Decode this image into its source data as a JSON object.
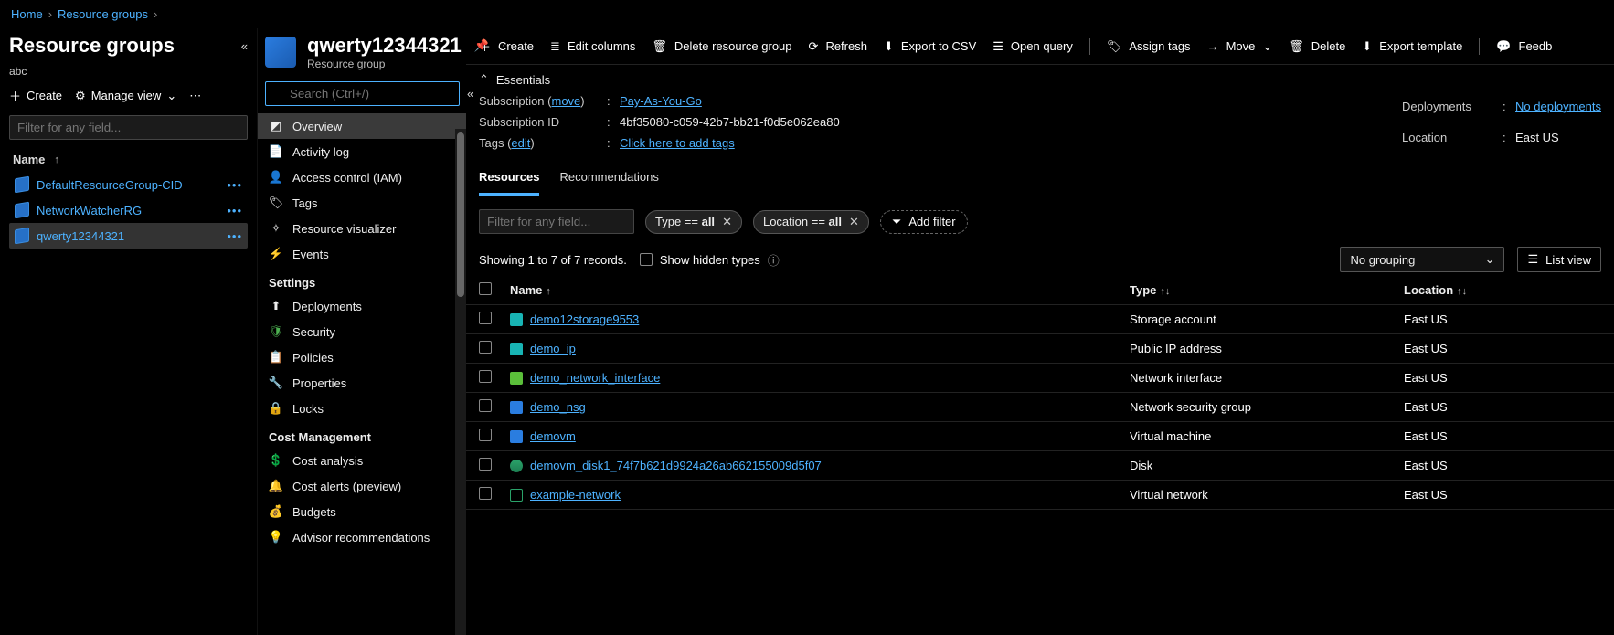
{
  "breadcrumb": {
    "home": "Home",
    "groups": "Resource groups"
  },
  "left": {
    "title": "Resource groups",
    "subtitle": "abc",
    "create": "Create",
    "manage": "Manage view",
    "filter_placeholder": "Filter for any field...",
    "name_header": "Name",
    "items": [
      {
        "name": "DefaultResourceGroup-CID"
      },
      {
        "name": "NetworkWatcherRG"
      },
      {
        "name": "qwerty12344321"
      }
    ]
  },
  "nav": {
    "title": "qwerty12344321",
    "subtitle": "Resource group",
    "search_placeholder": "Search (Ctrl+/)",
    "items": [
      {
        "label": "Overview",
        "icon": "cube",
        "selected": true
      },
      {
        "label": "Activity log",
        "icon": "log"
      },
      {
        "label": "Access control (IAM)",
        "icon": "person"
      },
      {
        "label": "Tags",
        "icon": "tag"
      },
      {
        "label": "Resource visualizer",
        "icon": "viz"
      },
      {
        "label": "Events",
        "icon": "bolt"
      }
    ],
    "section_settings": "Settings",
    "settings": [
      {
        "label": "Deployments",
        "icon": "upload"
      },
      {
        "label": "Security",
        "icon": "shield"
      },
      {
        "label": "Policies",
        "icon": "policy"
      },
      {
        "label": "Properties",
        "icon": "props"
      },
      {
        "label": "Locks",
        "icon": "lock"
      }
    ],
    "section_cost": "Cost Management",
    "cost": [
      {
        "label": "Cost analysis",
        "icon": "cost"
      },
      {
        "label": "Cost alerts (preview)",
        "icon": "alert"
      },
      {
        "label": "Budgets",
        "icon": "budget"
      },
      {
        "label": "Advisor recommendations",
        "icon": "advisor"
      }
    ]
  },
  "toolbar": {
    "create": "Create",
    "edit_columns": "Edit columns",
    "delete_rg": "Delete resource group",
    "refresh": "Refresh",
    "export_csv": "Export to CSV",
    "open_query": "Open query",
    "assign_tags": "Assign tags",
    "move": "Move",
    "delete": "Delete",
    "export_template": "Export template",
    "feedback": "Feedb"
  },
  "essentials": {
    "header": "Essentials",
    "subscription_label": "Subscription",
    "move_link": "move",
    "subscription_value": "Pay-As-You-Go",
    "subscription_id_label": "Subscription ID",
    "subscription_id_value": "4bf35080-c059-42b7-bb21-f0d5e062ea80",
    "tags_label": "Tags",
    "tags_edit": "edit",
    "tags_value": "Click here to add tags",
    "deployments_label": "Deployments",
    "deployments_value": "No deployments",
    "location_label": "Location",
    "location_value": "East US"
  },
  "tabs": {
    "resources": "Resources",
    "recommendations": "Recommendations"
  },
  "filters": {
    "filter_placeholder": "Filter for any field...",
    "type_pill_prefix": "Type == ",
    "type_pill_value": "all",
    "location_pill_prefix": "Location == ",
    "location_pill_value": "all",
    "add_filter": "Add filter"
  },
  "records": {
    "showing": "Showing 1 to 7 of 7 records.",
    "show_hidden": "Show hidden types",
    "no_grouping": "No grouping",
    "list_view": "List view"
  },
  "table": {
    "headers": {
      "name": "Name",
      "type": "Type",
      "location": "Location"
    },
    "rows": [
      {
        "name": "demo12storage9553",
        "type": "Storage account",
        "location": "East US",
        "icon": "teal"
      },
      {
        "name": "demo_ip",
        "type": "Public IP address",
        "location": "East US",
        "icon": "teal"
      },
      {
        "name": "demo_network_interface",
        "type": "Network interface",
        "location": "East US",
        "icon": "green"
      },
      {
        "name": "demo_nsg",
        "type": "Network security group",
        "location": "East US",
        "icon": "bshield"
      },
      {
        "name": "demovm",
        "type": "Virtual machine",
        "location": "East US",
        "icon": "blue"
      },
      {
        "name": "demovm_disk1_74f7b621d9924a26ab662155009d5f07",
        "type": "Disk",
        "location": "East US",
        "icon": "disk"
      },
      {
        "name": "example-network",
        "type": "Virtual network",
        "location": "East US",
        "icon": "net"
      }
    ]
  }
}
